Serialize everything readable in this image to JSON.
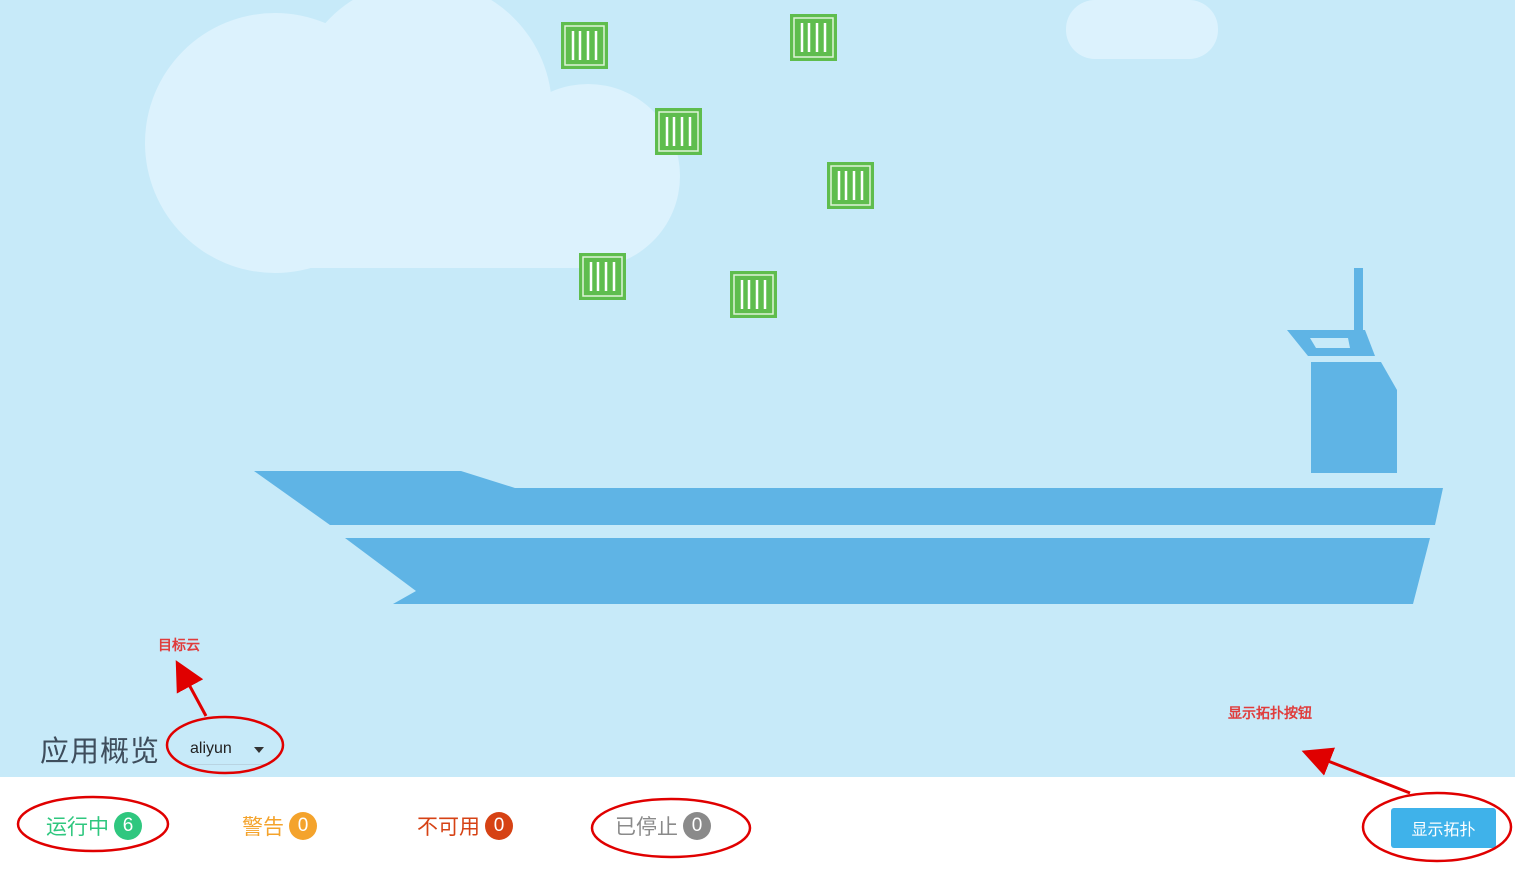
{
  "overview": {
    "title": "应用概览",
    "target_cloud": "aliyun"
  },
  "statuses": {
    "running": {
      "label": "运行中",
      "count": "6"
    },
    "warning": {
      "label": "警告",
      "count": "0"
    },
    "unavailable": {
      "label": "不可用",
      "count": "0"
    },
    "stopped": {
      "label": "已停止",
      "count": "0"
    }
  },
  "actions": {
    "show_topology": "显示拓扑"
  },
  "annotations": {
    "target_cloud": "目标云",
    "show_topology_button": "显示拓扑按钮"
  },
  "colors": {
    "sky": "#c7eaf9",
    "ship": "#5fb4e5",
    "container": "#5fbd4e",
    "running": "#2fc77f",
    "warning": "#f4a32c",
    "unavailable": "#d64214",
    "stopped": "#8a8a8a",
    "primary_button": "#3fb2ea",
    "annotation": "#e00000"
  }
}
